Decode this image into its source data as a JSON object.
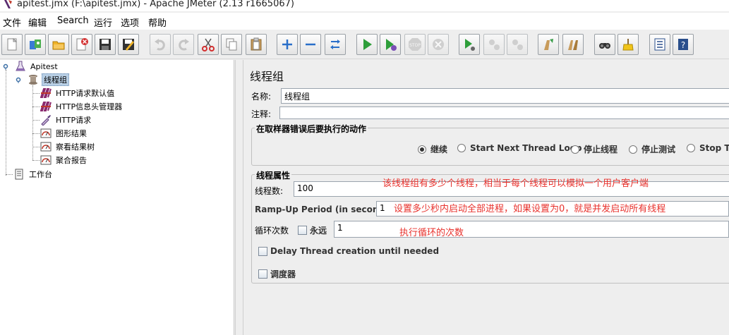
{
  "window": {
    "title": "apitest.jmx (F:\\apitest.jmx) - Apache JMeter (2.13 r1665067)"
  },
  "menu": [
    "文件",
    "编辑",
    "Search",
    "运行",
    "选项",
    "帮助"
  ],
  "toolbar": [
    {
      "icon": "new-icon"
    },
    {
      "icon": "templates-icon"
    },
    {
      "icon": "open-icon"
    },
    {
      "icon": "close-icon"
    },
    {
      "icon": "save-icon"
    },
    {
      "icon": "save-as-icon"
    },
    {
      "icon": "undo-icon"
    },
    {
      "icon": "redo-icon"
    },
    {
      "icon": "cut-icon"
    },
    {
      "icon": "copy-icon"
    },
    {
      "icon": "paste-icon"
    },
    {
      "icon": "expand-icon"
    },
    {
      "icon": "collapse-icon"
    },
    {
      "icon": "toggle-icon"
    },
    {
      "icon": "start-icon"
    },
    {
      "icon": "start-no-pause-icon"
    },
    {
      "icon": "stop-icon"
    },
    {
      "icon": "shutdown-icon"
    },
    {
      "icon": "remote-start-icon"
    },
    {
      "icon": "remote-stop-icon"
    },
    {
      "icon": "remote-shutdown-icon"
    },
    {
      "icon": "clear-icon"
    },
    {
      "icon": "clear-all-icon"
    },
    {
      "icon": "search-icon"
    },
    {
      "icon": "reset-search-icon"
    },
    {
      "icon": "function-helper-icon"
    },
    {
      "icon": "help-icon"
    }
  ],
  "tree": {
    "root": "Apitest",
    "thread_group": "线程组",
    "children": [
      "HTTP请求默认值",
      "HTTP信息头管理器",
      "HTTP请求",
      "图形结果",
      "察看结果树",
      "聚合报告"
    ],
    "workbench": "工作台"
  },
  "panel": {
    "title": "线程组",
    "name_label": "名称:",
    "name_value": "线程组",
    "comment_label": "注释:",
    "comment_value": "",
    "error_group_title": "在取样器错误后要执行的动作",
    "error_actions": [
      "继续",
      "Start Next Thread Loop",
      "停止线程",
      "停止测试",
      "Stop Te"
    ],
    "error_selected": 0,
    "props_title": "线程属性",
    "threads_label": "线程数:",
    "threads_value": "100",
    "rampup_label": "Ramp-Up Period (in seconds):",
    "rampup_value": "1",
    "loop_label": "循环次数",
    "forever_label": "永远",
    "loop_value": "1",
    "delay_label": "Delay Thread creation until needed",
    "scheduler_label": "调度器"
  },
  "annotations": {
    "threads": "该线程组有多少个线程，相当于每个线程可以模拟一个用户客户端",
    "rampup": "设置多少秒内启动全部进程，如果设置为0，就是并发启动所有线程",
    "loop": "执行循环的次数"
  },
  "colors": {
    "annotation": "#e8322d",
    "selection": "#b8cfe5"
  }
}
